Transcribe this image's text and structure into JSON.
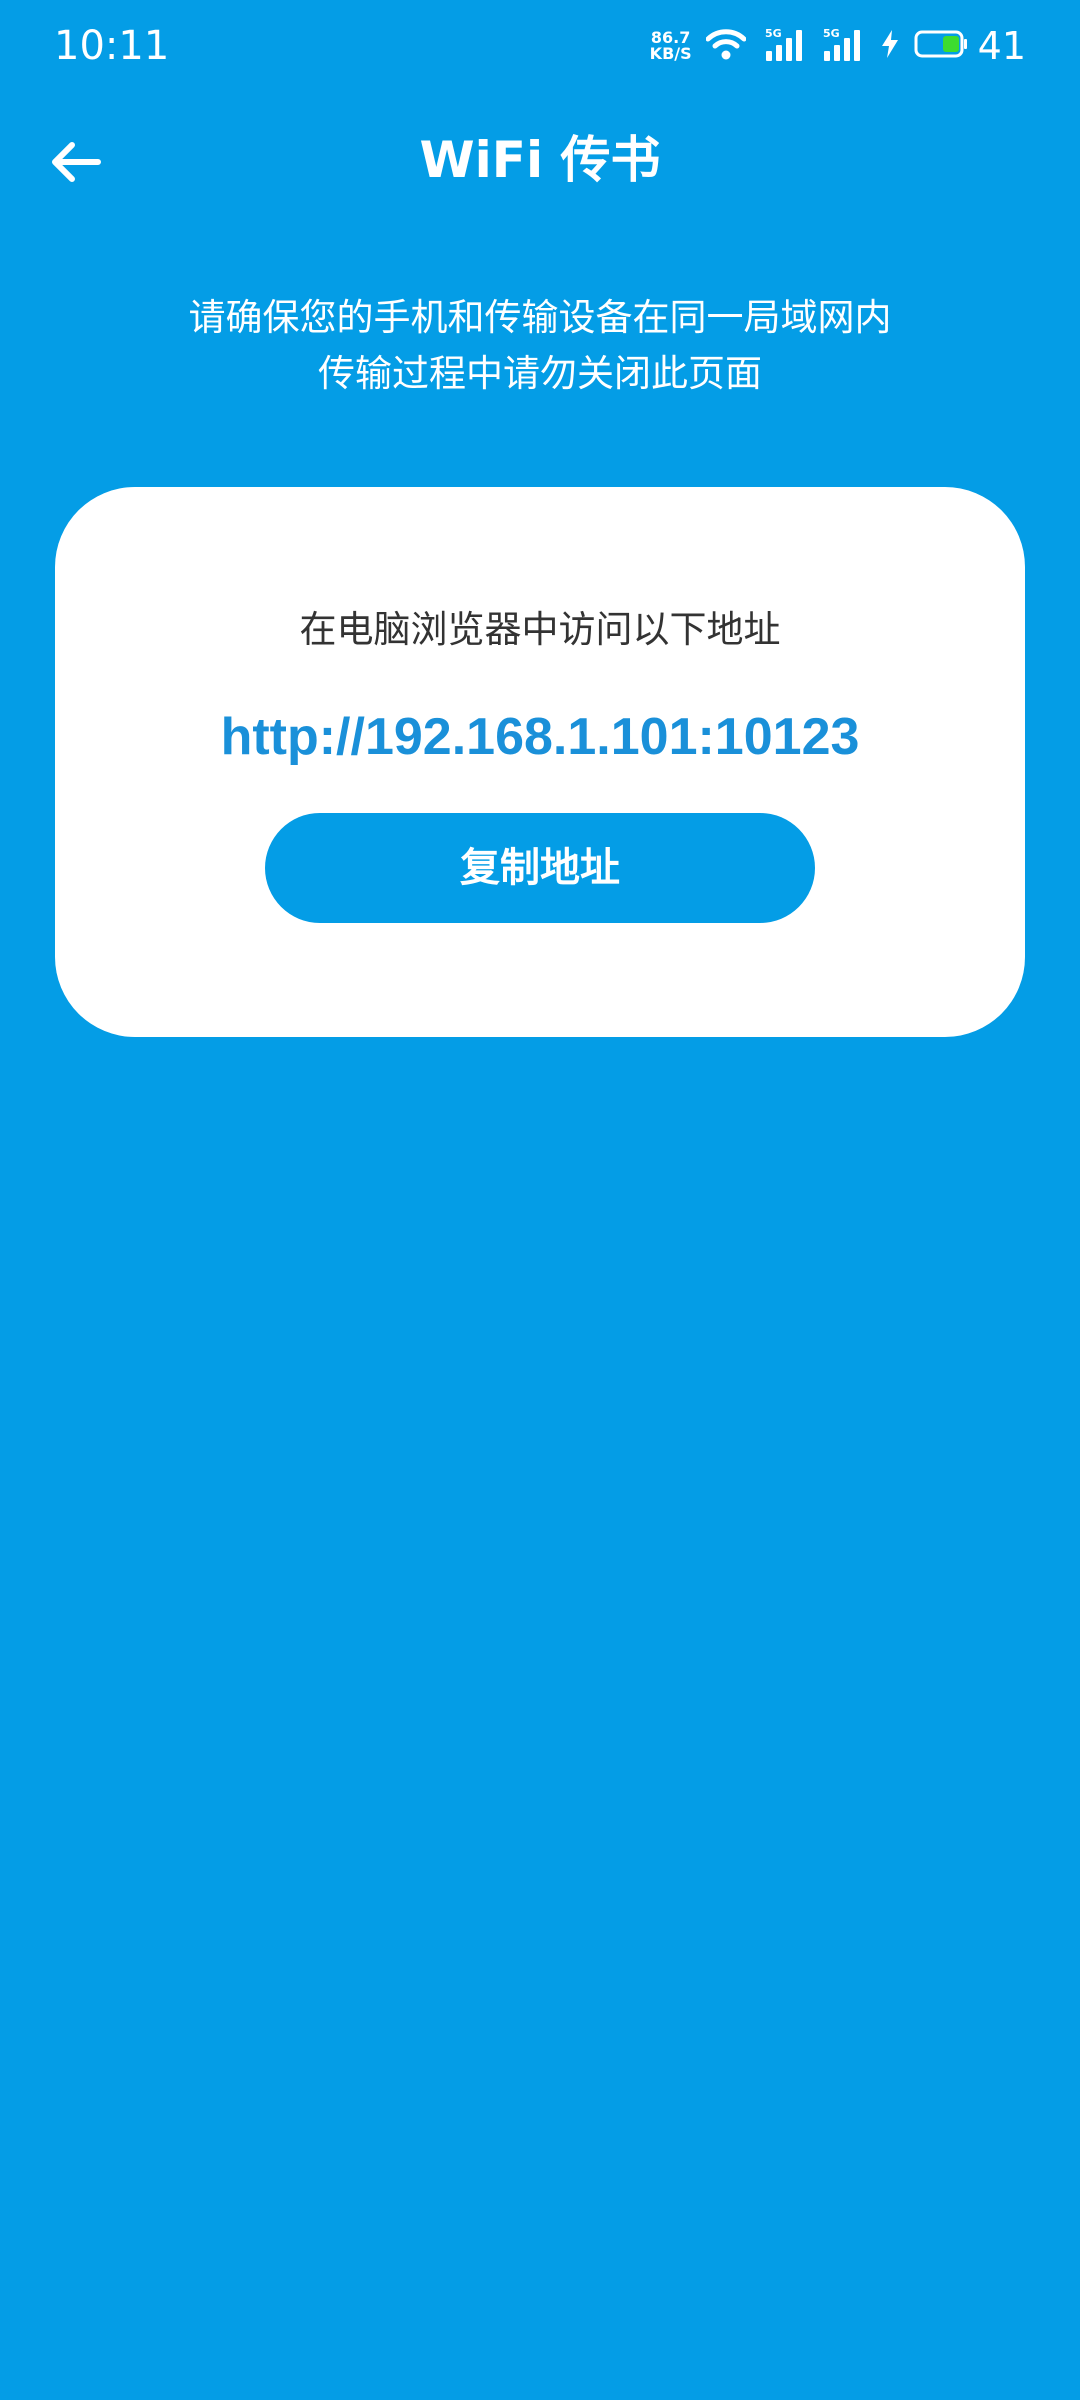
{
  "status_bar": {
    "time": "10:11",
    "net_speed_value": "86.7",
    "net_speed_unit": "KB/S",
    "signal1_label": "5G",
    "signal2_label": "5G",
    "battery_level": "41",
    "icons": [
      "wifi-icon",
      "signal-icon",
      "signal-icon",
      "charging-bolt-icon",
      "battery-icon"
    ]
  },
  "header": {
    "title": "WiFi 传书",
    "back_icon": "back-arrow-icon"
  },
  "instructions": {
    "line1": "请确保您的手机和传输设备在同一局域网内",
    "line2": "传输过程中请勿关闭此页面"
  },
  "card": {
    "prompt": "在电脑浏览器中访问以下地址",
    "url": "http://192.168.1.101:10123",
    "copy_button_label": "复制地址"
  },
  "colors": {
    "background": "#049de6",
    "card": "#ffffff",
    "url_text": "#1a90d9",
    "prompt_text": "#333333",
    "battery_fill": "#3ddc2f"
  }
}
